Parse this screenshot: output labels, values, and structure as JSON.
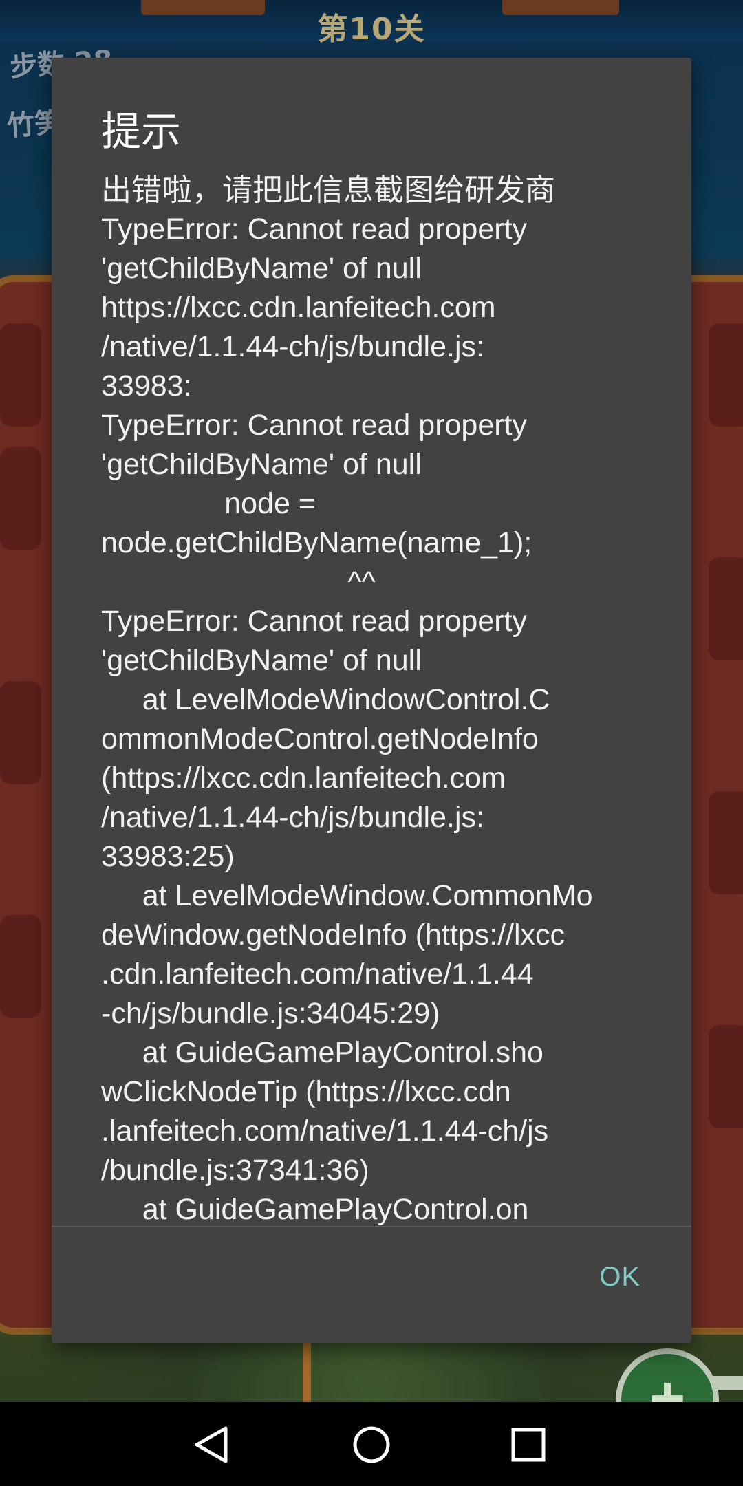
{
  "game": {
    "level_title": "第10关",
    "steps_label": "步数 28",
    "bamboo_label": "竹笋"
  },
  "dialog": {
    "title": "提示",
    "message_lines": [
      "出错啦，请把此信息截图给研发商",
      "TypeError: Cannot read property",
      "'getChildByName' of null",
      "https://lxcc.cdn.lanfeitech.com",
      "/native/1.1.44-ch/js/bundle.js:",
      "33983:",
      "TypeError: Cannot read property",
      "'getChildByName' of null",
      "               node =",
      "node.getChildByName(name_1);",
      "                              ^^",
      "TypeError: Cannot read property",
      "'getChildByName' of null",
      "     at LevelModeWindowControl.C",
      "ommonModeControl.getNodeInfo",
      "(https://lxcc.cdn.lanfeitech.com",
      "/native/1.1.44-ch/js/bundle.js:",
      "33983:25)",
      "     at LevelModeWindow.CommonMo",
      "deWindow.getNodeInfo (https://lxcc",
      ".cdn.lanfeitech.com/native/1.1.44",
      "-ch/js/bundle.js:34045:29)",
      "     at GuideGamePlayControl.sho",
      "wClickNodeTip (https://lxcc.cdn",
      ".lanfeitech.com/native/1.1.44-ch/js",
      "/bundle.js:37341:36)",
      "     at GuideGamePlayControl.on"
    ],
    "ok_label": "OK",
    "accent_color": "#80cbc4"
  },
  "nav": {
    "back_icon": "back-triangle-icon",
    "home_icon": "home-circle-icon",
    "recents_icon": "recents-square-icon"
  }
}
